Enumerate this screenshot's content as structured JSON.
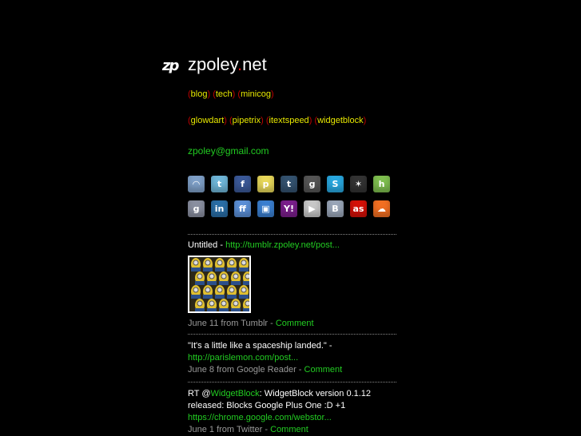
{
  "header": {
    "logo": "zp",
    "title_main": "zpoley",
    "title_dot": ".",
    "title_tld": "net"
  },
  "nav_row1": [
    "blog",
    "tech",
    "minicog"
  ],
  "nav_row2": [
    "glowdart",
    "pipetrix",
    "itextspeed",
    "widgetblock"
  ],
  "email": "zpoley@gmail.com",
  "social_icons": [
    {
      "name": "rss-icon",
      "glyph": "◠",
      "color": "#7fa0c8"
    },
    {
      "name": "twitter-icon",
      "glyph": "t",
      "color": "#6fb6d8"
    },
    {
      "name": "facebook-icon",
      "glyph": "f",
      "color": "#3b5998"
    },
    {
      "name": "posterous-icon",
      "glyph": "p",
      "color": "#e8d85a"
    },
    {
      "name": "tumblr-icon",
      "glyph": "t",
      "color": "#34526f"
    },
    {
      "name": "goodreads-icon",
      "glyph": "g",
      "color": "#555555"
    },
    {
      "name": "skype-icon",
      "glyph": "S",
      "color": "#29a8e0"
    },
    {
      "name": "picasa-icon",
      "glyph": "✶",
      "color": "#333333"
    },
    {
      "name": "hunch-icon",
      "glyph": "h",
      "color": "#7fbf4f"
    },
    {
      "name": "google-icon",
      "glyph": "g",
      "color": "#8a8fa0"
    },
    {
      "name": "linkedin-icon",
      "glyph": "in",
      "color": "#2a6ea6"
    },
    {
      "name": "friendfeed-icon",
      "glyph": "ff",
      "color": "#5b8fd6"
    },
    {
      "name": "delicious-icon",
      "glyph": "▣",
      "color": "#3a7fd0"
    },
    {
      "name": "yahoo-icon",
      "glyph": "Y!",
      "color": "#7b1f8c"
    },
    {
      "name": "youtube-icon",
      "glyph": "▶",
      "color": "#c8c8c8"
    },
    {
      "name": "blogger-icon",
      "glyph": "B",
      "color": "#9aa6b8"
    },
    {
      "name": "lastfm-icon",
      "glyph": "as",
      "color": "#d51007"
    },
    {
      "name": "soundcloud-icon",
      "glyph": "☁",
      "color": "#f26f22"
    }
  ],
  "feed": [
    {
      "title": "Untitled",
      "sep": " - ",
      "link": "http://tumblr.zpoley.net/post...",
      "date": "June 11 from Tumblr",
      "dash": " - ",
      "comment": "Comment"
    },
    {
      "quote": "\"It's a little like a spaceship landed.\"",
      "sep": " -",
      "link": "http://parislemon.com/post...",
      "date": "June 8 from Google Reader",
      "dash": " - ",
      "comment": "Comment"
    },
    {
      "prefix": "RT @",
      "mention": "WidgetBlock",
      "body": ": WidgetBlock version 0.1.12 released: Blocks Google Plus One :D +1",
      "link": "https://chrome.google.com/webstor...",
      "date": "June 1 from Twitter",
      "dash": " - ",
      "comment": "Comment"
    }
  ]
}
